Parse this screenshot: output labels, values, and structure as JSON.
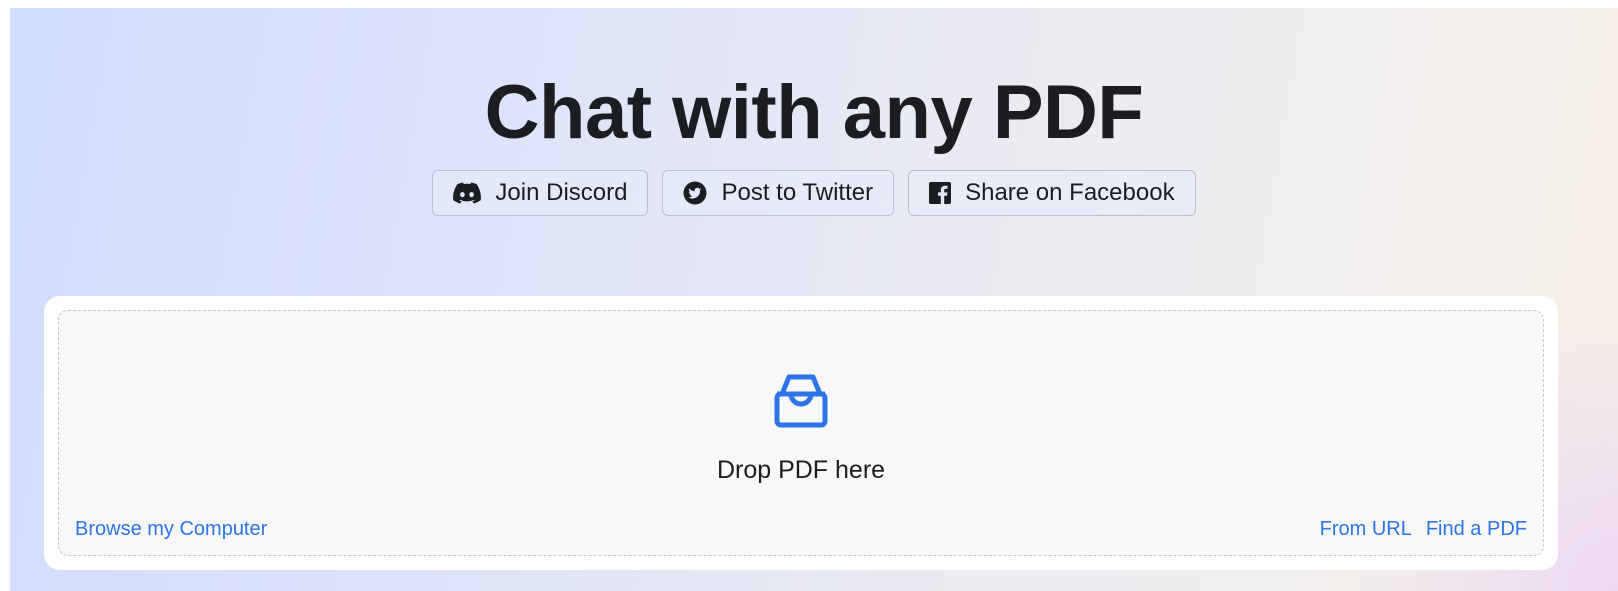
{
  "hero": {
    "title": "Chat with any PDF"
  },
  "share_buttons": [
    {
      "label": "Join Discord",
      "icon": "discord-icon"
    },
    {
      "label": "Post to Twitter",
      "icon": "twitter-icon"
    },
    {
      "label": "Share on Facebook",
      "icon": "facebook-icon"
    }
  ],
  "upload": {
    "icon": "inbox-icon",
    "drop_label": "Drop PDF here",
    "browse_label": "Browse my Computer",
    "from_url_label": "From URL",
    "find_pdf_label": "Find a PDF"
  },
  "colors": {
    "accent": "#2c74e8",
    "text": "#1c1d22"
  }
}
